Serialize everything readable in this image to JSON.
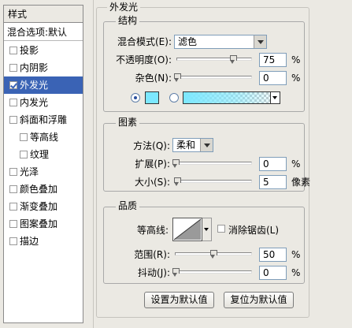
{
  "sidebar": {
    "header": "样式",
    "blend_options": "混合选项:默认",
    "items": [
      {
        "label": "投影",
        "checked": false,
        "indent": false,
        "selected": false
      },
      {
        "label": "内阴影",
        "checked": false,
        "indent": false,
        "selected": false
      },
      {
        "label": "外发光",
        "checked": true,
        "indent": false,
        "selected": true
      },
      {
        "label": "内发光",
        "checked": false,
        "indent": false,
        "selected": false
      },
      {
        "label": "斜面和浮雕",
        "checked": false,
        "indent": false,
        "selected": false
      },
      {
        "label": "等高线",
        "checked": false,
        "indent": true,
        "selected": false
      },
      {
        "label": "纹理",
        "checked": false,
        "indent": true,
        "selected": false
      },
      {
        "label": "光泽",
        "checked": false,
        "indent": false,
        "selected": false
      },
      {
        "label": "颜色叠加",
        "checked": false,
        "indent": false,
        "selected": false
      },
      {
        "label": "渐变叠加",
        "checked": false,
        "indent": false,
        "selected": false
      },
      {
        "label": "图案叠加",
        "checked": false,
        "indent": false,
        "selected": false
      },
      {
        "label": "描边",
        "checked": false,
        "indent": false,
        "selected": false
      }
    ]
  },
  "outer_glow": {
    "title": "外发光",
    "structure": {
      "title": "结构",
      "blend_mode_label": "混合模式(E):",
      "blend_mode_value": "滤色",
      "opacity_label": "不透明度(O):",
      "opacity_value": "75",
      "opacity_unit": "%",
      "opacity_level": 0.75,
      "noise_label": "杂色(N):",
      "noise_value": "0",
      "noise_unit": "%",
      "noise_level": 0,
      "color_mode": "solid",
      "color_swatch": "#7ce8ff"
    },
    "elements": {
      "title": "图素",
      "method_label": "方法(Q):",
      "method_value": "柔和",
      "spread_label": "扩展(P):",
      "spread_value": "0",
      "spread_unit": "%",
      "spread_level": 0,
      "size_label": "大小(S):",
      "size_value": "5",
      "size_unit": "像素",
      "size_level": 0.02
    },
    "quality": {
      "title": "品质",
      "contour_label": "等高线:",
      "antialias_label": "消除锯齿(L)",
      "antialias_checked": false,
      "range_label": "范围(R):",
      "range_value": "50",
      "range_unit": "%",
      "range_level": 0.5,
      "jitter_label": "抖动(J):",
      "jitter_value": "0",
      "jitter_unit": "%",
      "jitter_level": 0
    },
    "buttons": {
      "set_default": "设置为默认值",
      "reset_default": "复位为默认值"
    }
  },
  "colors": {
    "selection": "#3a63b5",
    "glow": "#7ce8ff"
  }
}
